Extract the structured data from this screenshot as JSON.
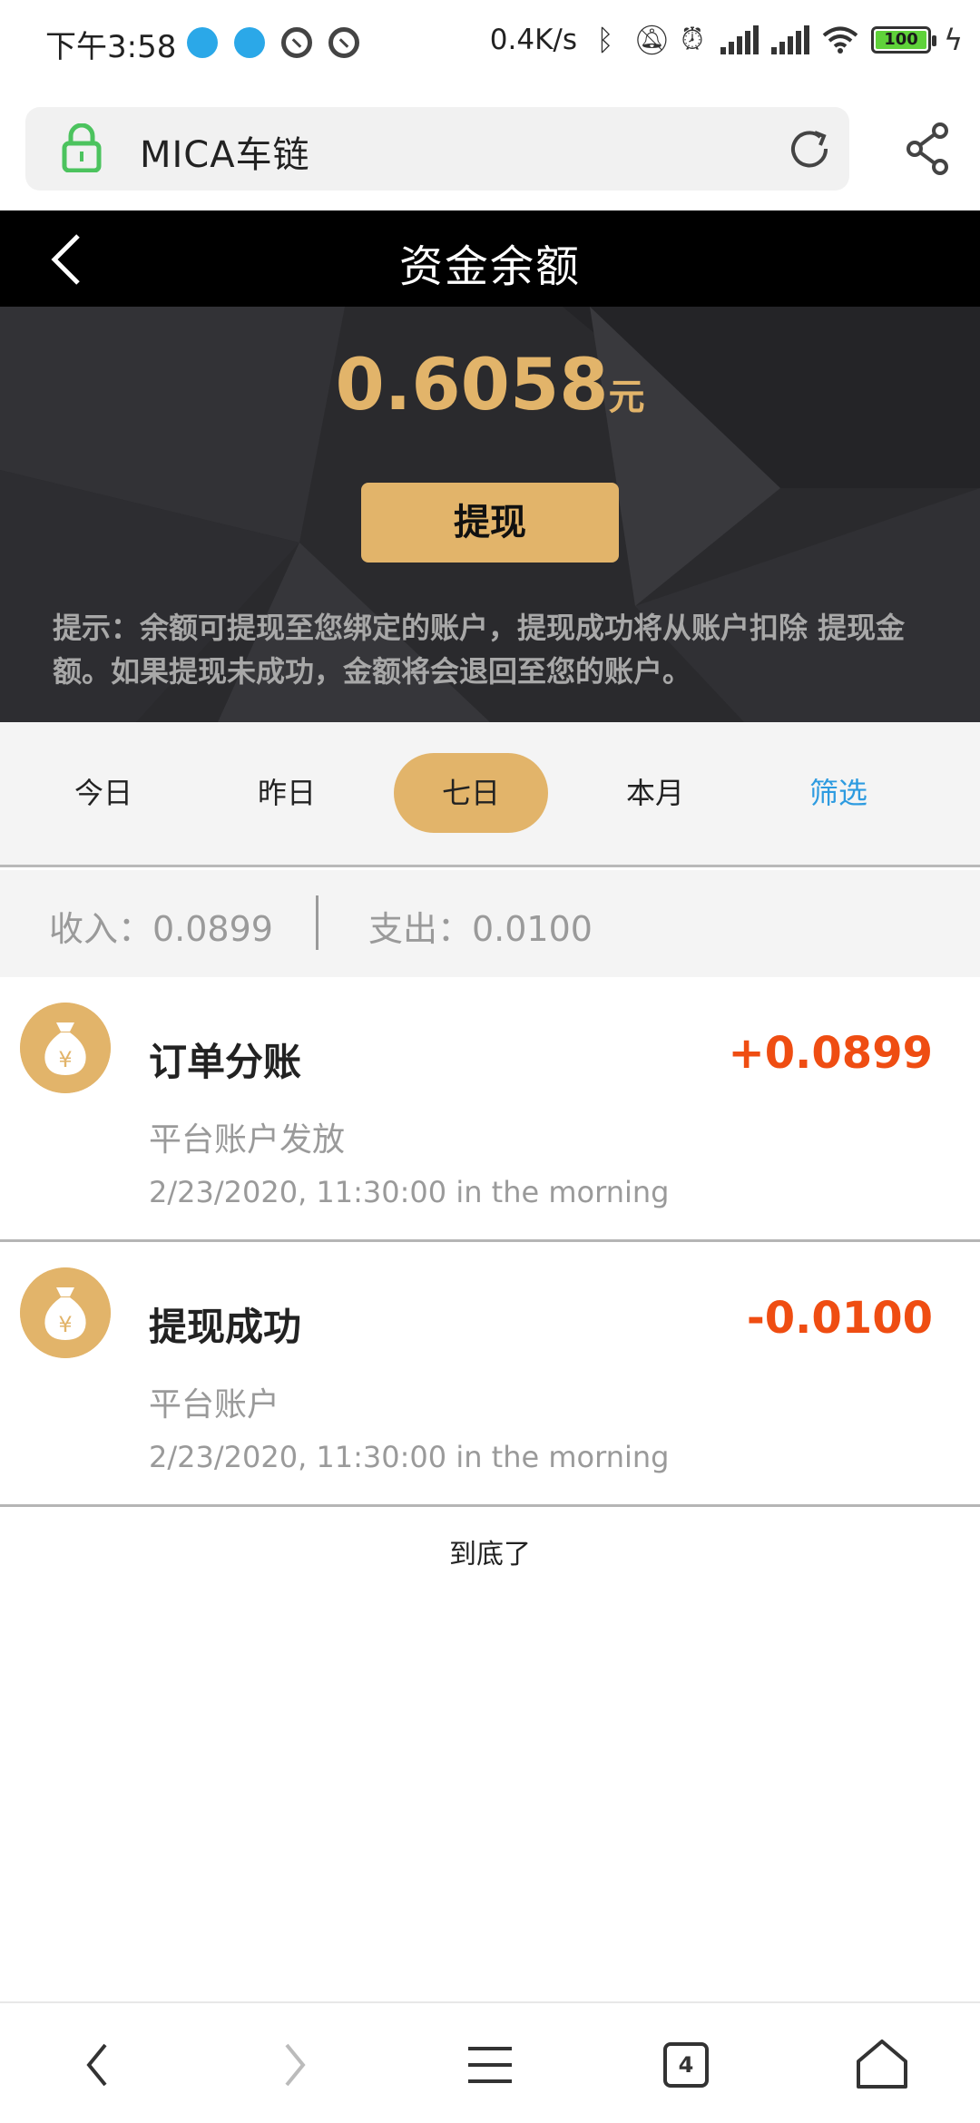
{
  "status_bar": {
    "time": "下午3:58",
    "speed": "0.4K/s",
    "battery": "100"
  },
  "browser": {
    "url_title": "MICA车链"
  },
  "header": {
    "title": "资金余额"
  },
  "balance": {
    "amount": "0.6058",
    "unit": "元",
    "withdraw_label": "提现",
    "hint": "提示：余额可提现至您绑定的账户，提现成功将从账户扣除 提现金额。如果提现未成功，金额将会退回至您的账户。"
  },
  "tabs": [
    {
      "label": "今日"
    },
    {
      "label": "昨日"
    },
    {
      "label": "七日",
      "active": true
    },
    {
      "label": "本月"
    },
    {
      "label": "筛选"
    }
  ],
  "summary": {
    "income": "收入：0.0899",
    "expense": "支出：0.0100"
  },
  "transactions": [
    {
      "title": "订单分账",
      "amount": "+0.0899",
      "source": "平台账户发放",
      "time": "2/23/2020, 11:30:00 in the morning"
    },
    {
      "title": "提现成功",
      "amount": "-0.0100",
      "source": "平台账户",
      "time": "2/23/2020, 11:30:00 in the morning"
    }
  ],
  "end_note": "到底了",
  "bottom_nav": {
    "tab_count": "4"
  },
  "colors": {
    "accent_gold": "#e2b46a",
    "amount_red": "#ef4d12",
    "filter_blue": "#2d9be0"
  }
}
